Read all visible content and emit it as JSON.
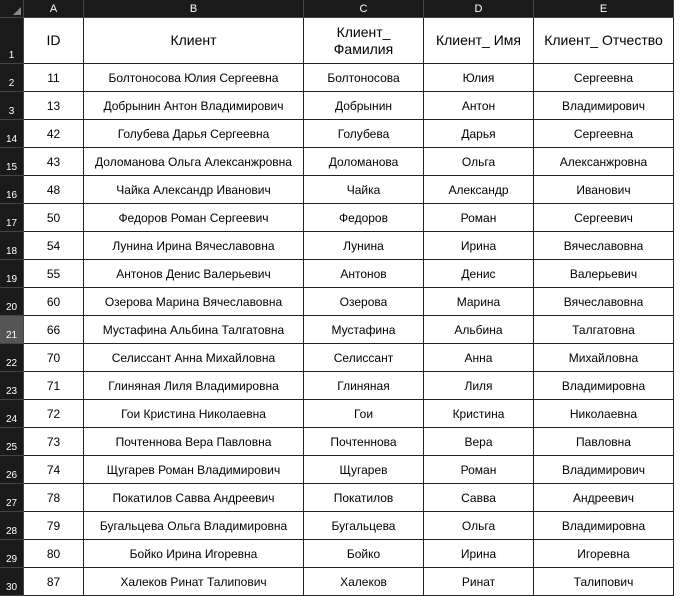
{
  "columns": [
    "A",
    "B",
    "C",
    "D",
    "E"
  ],
  "headers": {
    "A": "ID",
    "B": "Клиент",
    "C": "Клиент_ Фамилия",
    "D": "Клиент_ Имя",
    "E": "Клиент_ Отчество"
  },
  "header_row_number": "1",
  "selected_row_number": "21",
  "rows": [
    {
      "n": "2",
      "A": "11",
      "B": "Болтоносова Юлия Сергеевна",
      "C": "Болтоносова",
      "D": "Юлия",
      "E": "Сергеевна"
    },
    {
      "n": "3",
      "A": "13",
      "B": "Добрынин Антон Владимирович",
      "C": "Добрынин",
      "D": "Антон",
      "E": "Владимирович"
    },
    {
      "n": "14",
      "A": "42",
      "B": "Голубева Дарья Сергеевна",
      "C": "Голубева",
      "D": "Дарья",
      "E": "Сергеевна"
    },
    {
      "n": "15",
      "A": "43",
      "B": "Доломанова Ольга Алексанжровна",
      "C": "Доломанова",
      "D": "Ольга",
      "E": "Алексанжровна"
    },
    {
      "n": "16",
      "A": "48",
      "B": "Чайка Александр Иванович",
      "C": "Чайка",
      "D": "Александр",
      "E": "Иванович"
    },
    {
      "n": "17",
      "A": "50",
      "B": "Федоров Роман Сергеевич",
      "C": "Федоров",
      "D": "Роман",
      "E": "Сергеевич"
    },
    {
      "n": "18",
      "A": "54",
      "B": "Лунина Ирина Вячеславовна",
      "C": "Лунина",
      "D": "Ирина",
      "E": "Вячеславовна"
    },
    {
      "n": "19",
      "A": "55",
      "B": "Антонов Денис Валерьевич",
      "C": "Антонов",
      "D": "Денис",
      "E": "Валерьевич"
    },
    {
      "n": "20",
      "A": "60",
      "B": "Озерова Марина Вячеславовна",
      "C": "Озерова",
      "D": "Марина",
      "E": "Вячеславовна"
    },
    {
      "n": "21",
      "A": "66",
      "B": "Мустафина Альбина Талгатовна",
      "C": "Мустафина",
      "D": "Альбина",
      "E": "Талгатовна"
    },
    {
      "n": "22",
      "A": "70",
      "B": "Селиссант Анна Михайловна",
      "C": "Селиссант",
      "D": "Анна",
      "E": "Михайловна"
    },
    {
      "n": "23",
      "A": "71",
      "B": "Глиняная Лиля Владимировна",
      "C": "Глиняная",
      "D": "Лиля",
      "E": "Владимировна"
    },
    {
      "n": "24",
      "A": "72",
      "B": "Гои Кристина Николаевна",
      "C": "Гои",
      "D": "Кристина",
      "E": "Николаевна"
    },
    {
      "n": "25",
      "A": "73",
      "B": "Почтеннова Вера Павловна",
      "C": "Почтеннова",
      "D": "Вера",
      "E": "Павловна"
    },
    {
      "n": "26",
      "A": "74",
      "B": "Щугарев Роман Владимирович",
      "C": "Щугарев",
      "D": "Роман",
      "E": "Владимирович"
    },
    {
      "n": "27",
      "A": "78",
      "B": "Покатилов Савва Андреевич",
      "C": "Покатилов",
      "D": "Савва",
      "E": "Андреевич"
    },
    {
      "n": "28",
      "A": "79",
      "B": "Бугальцева Ольга Владимировна",
      "C": "Бугальцева",
      "D": "Ольга",
      "E": "Владимировна"
    },
    {
      "n": "29",
      "A": "80",
      "B": "Бойко Ирина Игоревна",
      "C": "Бойко",
      "D": "Ирина",
      "E": "Игоревна"
    },
    {
      "n": "30",
      "A": "87",
      "B": "Халеков Ринат Талипович",
      "C": "Халеков",
      "D": "Ринат",
      "E": "Талипович"
    }
  ]
}
